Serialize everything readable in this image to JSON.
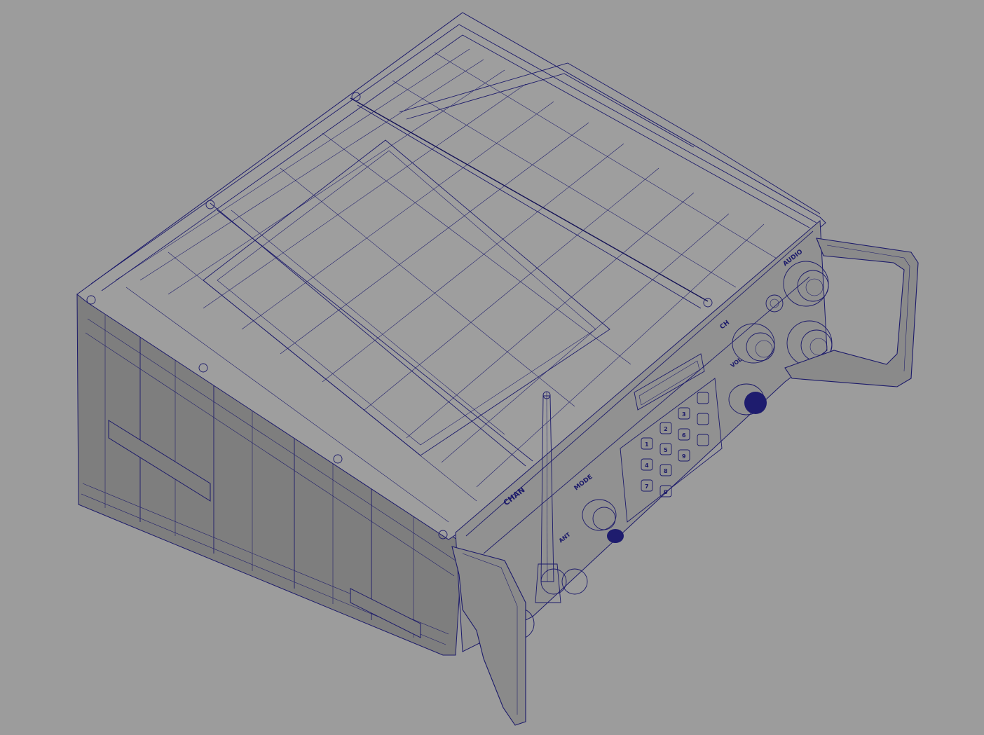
{
  "scene": {
    "background": "#9c9c9c",
    "wire_color": "#1c1a6a",
    "subject": "wireframe-radio-unit"
  },
  "keypad": {
    "keys": [
      "1",
      "2",
      "3",
      "4",
      "5",
      "6",
      "7",
      "8",
      "9",
      "0",
      "",
      "",
      ""
    ]
  },
  "panel_labels": {
    "chan": "CHAN",
    "mode": "MODE",
    "ch": "CH",
    "audio": "AUDIO",
    "ant": "ANT",
    "vol": "VOL"
  }
}
